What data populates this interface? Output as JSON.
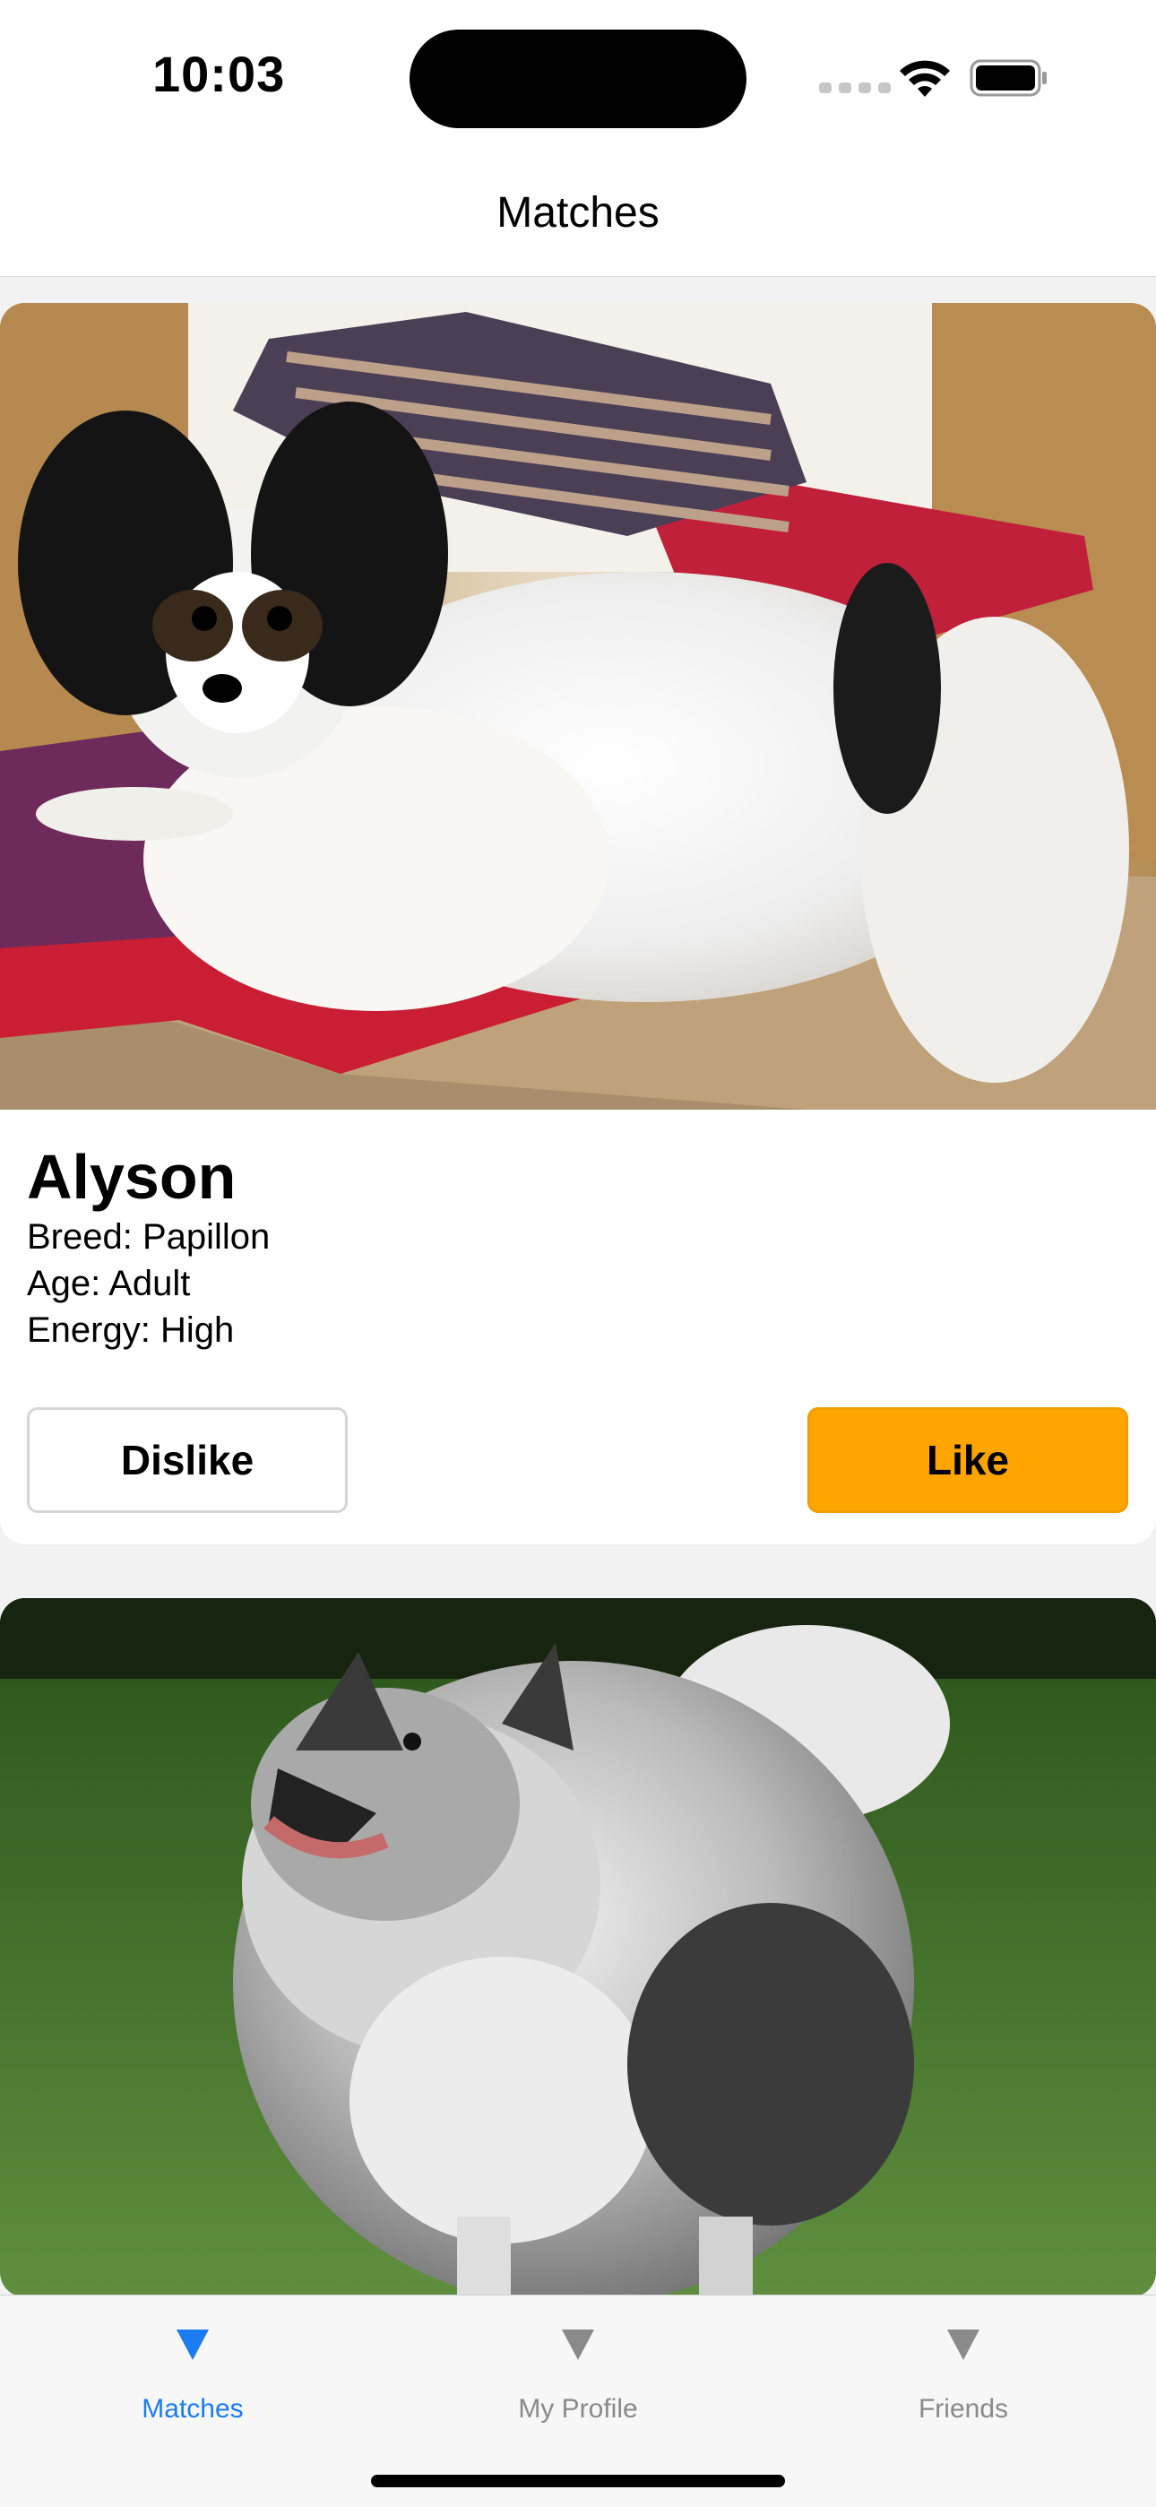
{
  "status_bar": {
    "time": "10:03"
  },
  "nav": {
    "title": "Matches"
  },
  "matches": [
    {
      "name": "Alyson",
      "breed_line": "Breed: Papillon",
      "age_line": "Age: Adult",
      "energy_line": "Energy: High",
      "dislike_label": "Dislike",
      "like_label": "Like"
    }
  ],
  "tabs": [
    {
      "label": "Matches",
      "icon": "triangle-down-icon",
      "selected": true
    },
    {
      "label": "My Profile",
      "icon": "triangle-down-icon",
      "selected": false
    },
    {
      "label": "Friends",
      "icon": "triangle-down-icon",
      "selected": false
    }
  ],
  "colors": {
    "accent": "#1a7cf0",
    "like_button": "#ffa500",
    "inactive_tab": "#8a8a8a"
  }
}
